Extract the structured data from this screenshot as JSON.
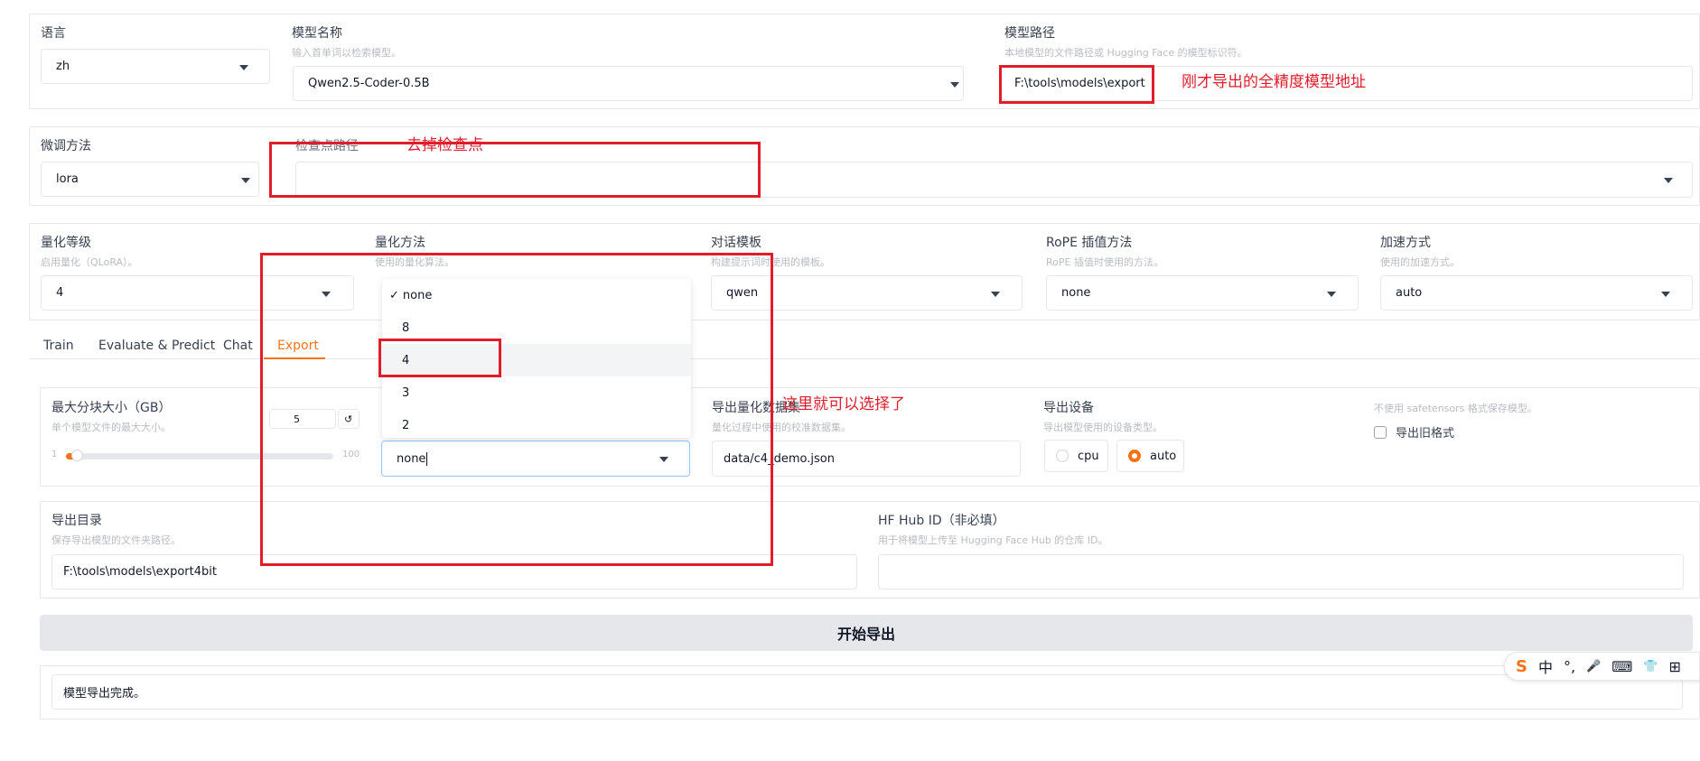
{
  "row1": {
    "language": {
      "label": "语言",
      "value": "zh"
    },
    "model_name": {
      "label": "模型名称",
      "info": "输入首单词以检索模型。",
      "value": "Qwen2.5-Coder-0.5B"
    },
    "model_path": {
      "label": "模型路径",
      "info": "本地模型的文件路径或 Hugging Face 的模型标识符。",
      "value": "F:\\tools\\models\\export"
    }
  },
  "row2": {
    "finetune": {
      "label": "微调方法",
      "value": "lora"
    },
    "checkpoint": {
      "label": "检查点路径",
      "value": ""
    }
  },
  "row3": {
    "quant_bit": {
      "label": "量化等级",
      "info": "启用量化（QLoRA）。",
      "value": "4"
    },
    "quant_method": {
      "label": "量化方法",
      "info": "使用的量化算法。"
    },
    "template": {
      "label": "对话模板",
      "info": "构建提示词时使用的模板。",
      "value": "qwen"
    },
    "rope": {
      "label": "RoPE 插值方法",
      "info": "RoPE 插值时使用的方法。",
      "value": "none"
    },
    "booster": {
      "label": "加速方式",
      "info": "使用的加速方式。",
      "value": "auto"
    }
  },
  "tabs": [
    "Train",
    "Evaluate & Predict",
    "Chat",
    "Export"
  ],
  "active_tab": "Export",
  "export": {
    "max_shard": {
      "label": "最大分块大小（GB）",
      "info": "单个模型文件的最大大小。",
      "value": "5",
      "min": "1",
      "max": "100",
      "fraction": 0.04,
      "reset_glyph": "↺"
    },
    "quant_dropdown": {
      "options": [
        "none",
        "8",
        "4",
        "3",
        "2"
      ],
      "selected": "none",
      "hovered": "4",
      "check": "✓",
      "input_value": "none"
    },
    "dataset": {
      "label": "导出量化数据集",
      "info": "量化过程中使用的校准数据集。",
      "value": "data/c4_demo.json"
    },
    "device": {
      "label": "导出设备",
      "info": "导出模型使用的设备类型。",
      "options": [
        "cpu",
        "auto"
      ],
      "selected": "auto"
    },
    "legacy": {
      "info": "不使用 safetensors 格式保存模型。",
      "label": "导出旧格式"
    },
    "dir": {
      "label": "导出目录",
      "info": "保存导出模型的文件夹路径。",
      "value": "F:\\tools\\models\\export4bit"
    },
    "hub": {
      "label": "HF Hub ID（非必填）",
      "info": "用于将模型上传至 Hugging Face Hub 的仓库 ID。",
      "value": ""
    },
    "button": "开始导出",
    "output": "模型导出完成。"
  },
  "annotations": {
    "model_path_note": "刚才导出的全精度模型地址",
    "checkpoint_note": "去掉检查点",
    "quant_note": "这里就可以选择了"
  },
  "ime": [
    "中",
    "°,",
    "🎤",
    "⌨",
    "👕",
    "⊞"
  ],
  "colors": {
    "accent": "#f97316",
    "annotation": "#e11d2b",
    "border": "#e5e7eb"
  }
}
